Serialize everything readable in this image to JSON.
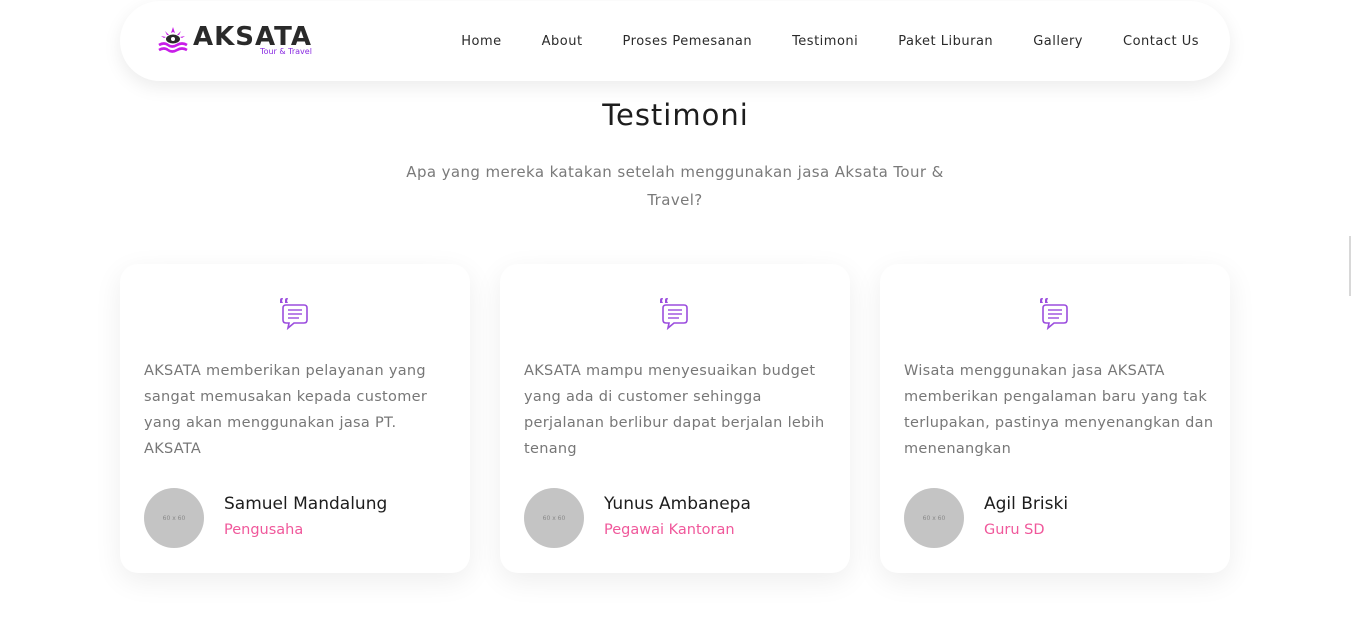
{
  "header": {
    "logo_name": "AKSATA",
    "logo_sub": "Tour & Travel",
    "nav": [
      {
        "label": "Home"
      },
      {
        "label": "About"
      },
      {
        "label": "Proses Pemesanan"
      },
      {
        "label": "Testimoni"
      },
      {
        "label": "Paket Liburan"
      },
      {
        "label": "Gallery"
      },
      {
        "label": "Contact Us"
      }
    ]
  },
  "section": {
    "title": "Testimoni",
    "subtitle": "Apa yang mereka katakan setelah menggunakan jasa Aksata Tour & Travel?"
  },
  "testimonials": [
    {
      "text": "AKSATA memberikan pelayanan yang sangat memusakan kepada customer yang akan menggunakan jasa PT. AKSATA",
      "avatar_placeholder": "60 x 60",
      "name": "Samuel Mandalung",
      "role": "Pengusaha"
    },
    {
      "text": "AKSATA mampu menyesuaikan budget yang ada di customer sehingga perjalanan berlibur dapat berjalan lebih tenang",
      "avatar_placeholder": "60 x 60",
      "name": "Yunus Ambanepa",
      "role": "Pegawai Kantoran"
    },
    {
      "text": "Wisata menggunakan jasa AKSATA memberikan pengalaman baru yang tak terlupakan, pastinya menyenangkan dan menenangkan",
      "avatar_placeholder": "60 x 60",
      "name": "Agil Briski",
      "role": "Guru SD"
    }
  ],
  "icons": {
    "logo": "logo-icon",
    "quote": "quote-chat-icon"
  },
  "colors": {
    "accent": "#9b4dde",
    "role": "#f0589b",
    "logo_wave": "#c81ee8"
  }
}
